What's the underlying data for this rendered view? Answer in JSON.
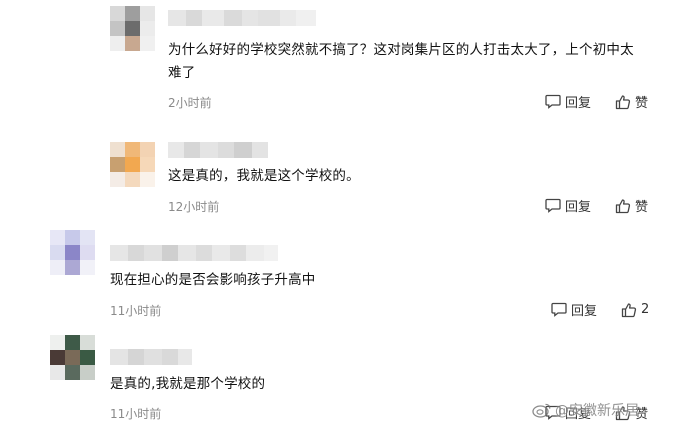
{
  "comments": [
    {
      "text_line1": "为什么好好的学校突然就不搞了？这对岗集片区的人打击太大了，上个初中太",
      "text_line2": "难了",
      "time": "2小时前",
      "reply_label": "回复",
      "like_label": "赞"
    },
    {
      "text": "这是真的，我就是这个学校的。",
      "time": "12小时前",
      "reply_label": "回复",
      "like_label": "赞"
    },
    {
      "text": "现在担心的是否会影响孩子升高中",
      "time": "11小时前",
      "reply_label": "回复",
      "like_count": "2"
    },
    {
      "text": "是真的,我就是那个学校的",
      "time": "11小时前",
      "reply_label": "回复",
      "like_label": "赞"
    }
  ],
  "watermark": {
    "text": "@安徽新乐居"
  },
  "colors": {
    "avatar1": [
      "#d8d8d8",
      "#9e9e9e",
      "#e6e6e6",
      "#c4c4c4",
      "#6c6c6c",
      "#ececec",
      "#eeeeee",
      "#c8a890",
      "#f0f0f0"
    ],
    "avatar2": [
      "#efe0d0",
      "#f0b878",
      "#f3d3b3",
      "#c8a070",
      "#f2a850",
      "#f6d8b8",
      "#f4ece6",
      "#f4d9bd",
      "#faf2ea"
    ],
    "avatar3": [
      "#e7e7f6",
      "#c7c9ea",
      "#e3e4f4",
      "#d9dbf0",
      "#8b86c8",
      "#dedcf1",
      "#eeeef7",
      "#aca8d4",
      "#f1f1f8"
    ],
    "avatar4": [
      "#eef0ee",
      "#3e5a48",
      "#d8ddd8",
      "#4a3a36",
      "#7a6a58",
      "#3a5a44",
      "#e8e8e8",
      "#5a6a5e",
      "#c8cec8"
    ]
  }
}
